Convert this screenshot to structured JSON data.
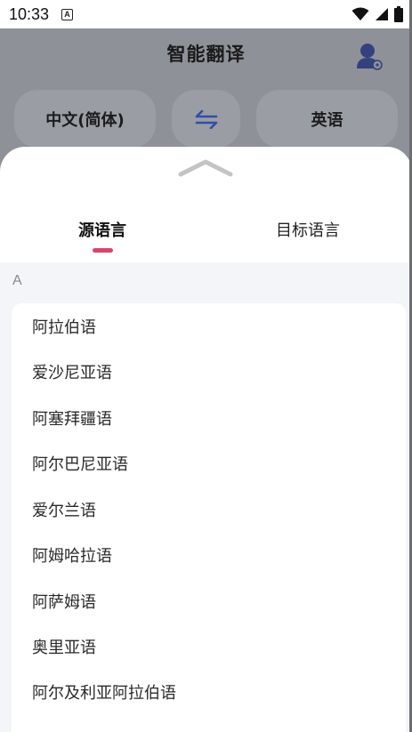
{
  "status_bar": {
    "time": "10:33",
    "notification_glyph": "A"
  },
  "header": {
    "title": "智能翻译"
  },
  "language_bar": {
    "source": "中文(简体)",
    "swap_icon": "swap-arrows-icon",
    "target": "英语"
  },
  "sheet": {
    "tabs": [
      {
        "label": "源语言",
        "active": true
      },
      {
        "label": "目标语言",
        "active": false
      }
    ],
    "sections": [
      {
        "letter": "A",
        "items": [
          "阿拉伯语",
          "爱沙尼亚语",
          "阿塞拜疆语",
          "阿尔巴尼亚语",
          "爱尔兰语",
          "阿姆哈拉语",
          "阿萨姆语",
          "奥里亚语",
          "阿尔及利亚阿拉伯语"
        ]
      }
    ]
  },
  "colors": {
    "accent": "#d7456a",
    "swap_icon": "#2f4fa8",
    "avatar": "#3b4a8a"
  }
}
